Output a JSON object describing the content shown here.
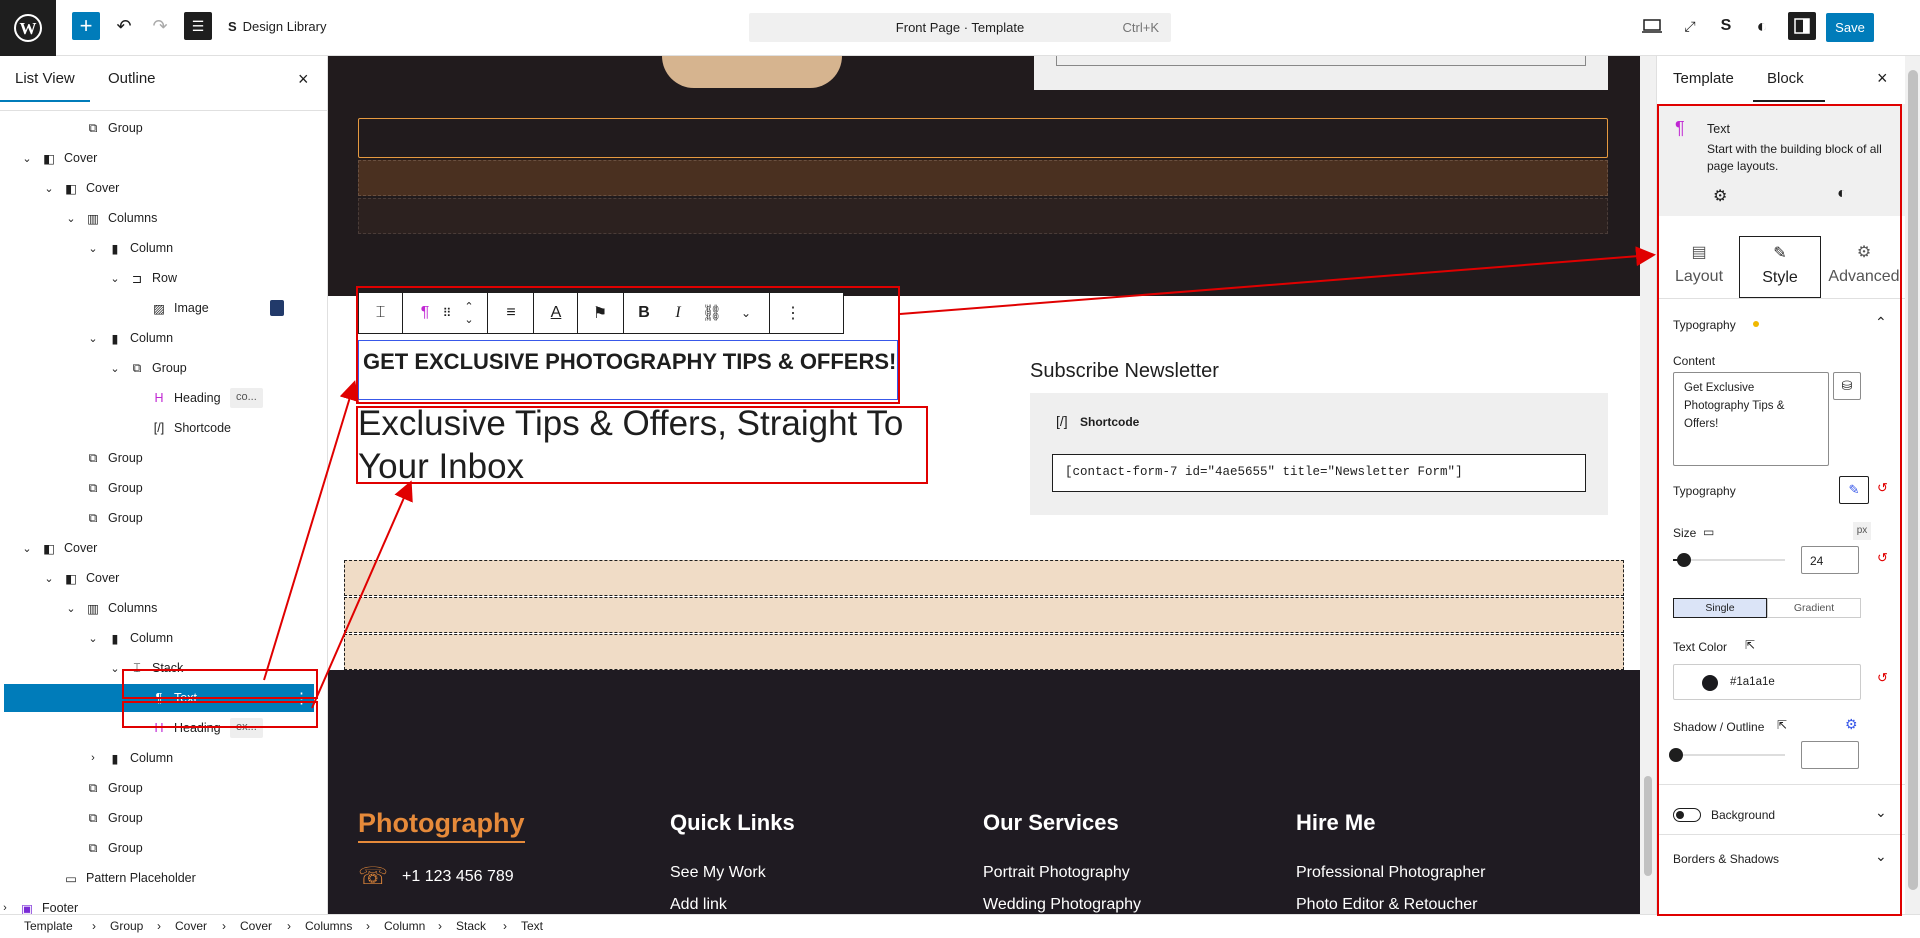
{
  "toolbar": {
    "design_library": "Design Library",
    "document_title": "Front Page · Template",
    "shortcut": "Ctrl+K",
    "save_label": "Save"
  },
  "left_panel": {
    "tabs": [
      "List View",
      "Outline"
    ],
    "rows": [
      {
        "label": "Group",
        "icon": "group-icon",
        "depth": 3
      },
      {
        "label": "Cover",
        "icon": "cover-icon",
        "depth": 1,
        "chev": "down"
      },
      {
        "label": "Cover",
        "icon": "cover-icon",
        "depth": 2,
        "chev": "down"
      },
      {
        "label": "Columns",
        "icon": "columns-icon",
        "depth": 3,
        "chev": "down"
      },
      {
        "label": "Column",
        "icon": "column-icon",
        "depth": 4,
        "chev": "down"
      },
      {
        "label": "Row",
        "icon": "row-icon",
        "depth": 5,
        "chev": "down"
      },
      {
        "label": "Image",
        "icon": "image-icon",
        "depth": 6,
        "thumb": true
      },
      {
        "label": "Column",
        "icon": "column-icon",
        "depth": 4,
        "chev": "down"
      },
      {
        "label": "Group",
        "icon": "group-icon",
        "depth": 5,
        "chev": "down"
      },
      {
        "label": "Heading",
        "icon": "heading-icon",
        "depth": 6,
        "pill": "co..."
      },
      {
        "label": "Shortcode",
        "icon": "shortcode-icon",
        "depth": 6
      },
      {
        "label": "Group",
        "icon": "group-icon",
        "depth": 3
      },
      {
        "label": "Group",
        "icon": "group-icon",
        "depth": 3
      },
      {
        "label": "Group",
        "icon": "group-icon",
        "depth": 3
      },
      {
        "label": "Cover",
        "icon": "cover-icon",
        "depth": 1,
        "chev": "down"
      },
      {
        "label": "Cover",
        "icon": "cover-icon",
        "depth": 2,
        "chev": "down"
      },
      {
        "label": "Columns",
        "icon": "columns-icon",
        "depth": 3,
        "chev": "down"
      },
      {
        "label": "Column",
        "icon": "column-icon",
        "depth": 4,
        "chev": "down"
      },
      {
        "label": "Stack",
        "icon": "stack-icon",
        "depth": 5,
        "chev": "down"
      },
      {
        "label": "Text",
        "icon": "paragraph-icon",
        "depth": 6,
        "selected": true
      },
      {
        "label": "Heading",
        "icon": "heading-icon",
        "depth": 6,
        "pill": "ex..."
      },
      {
        "label": "Column",
        "icon": "column-icon",
        "depth": 4,
        "chev": "right"
      },
      {
        "label": "Group",
        "icon": "group-icon",
        "depth": 3
      },
      {
        "label": "Group",
        "icon": "group-icon",
        "depth": 3
      },
      {
        "label": "Group",
        "icon": "group-icon",
        "depth": 3
      },
      {
        "label": "Pattern Placeholder",
        "icon": "pattern-icon",
        "depth": 2
      },
      {
        "label": "Footer",
        "icon": "footer-icon",
        "depth": 0,
        "chev": "right"
      }
    ]
  },
  "canvas": {
    "text_block": "GET EXCLUSIVE PHOTOGRAPHY TIPS & OFFERS!",
    "heading_line1": "Exclusive Tips & Offers, Straight To",
    "heading_line2": "Your Inbox",
    "subscribe_title": "Subscribe Newsletter",
    "shortcode_label": "Shortcode",
    "shortcode_value": "[contact-form-7 id=\"4ae5655\" title=\"Newsletter Form\"]",
    "footer": {
      "brand": "Photography",
      "phone": "+1 123 456 789",
      "col1_title": "Quick Links",
      "col1_items": [
        "See My Work",
        "Add link"
      ],
      "col2_title": "Our Services",
      "col2_items": [
        "Portrait Photography",
        "Wedding Photography"
      ],
      "col3_title": "Hire Me",
      "col3_items": [
        "Professional Photographer",
        "Photo Editor & Retoucher"
      ]
    }
  },
  "right_panel": {
    "tabs": [
      "Template",
      "Block"
    ],
    "block_name": "Text",
    "block_desc": "Start with the building block of all page layouts.",
    "sub_tabs": [
      "Layout",
      "Style",
      "Advanced"
    ],
    "typography_section": "Typography",
    "content_label": "Content",
    "content_value": "Get Exclusive Photography Tips & Offers!",
    "typography_label": "Typography",
    "size_label": "Size",
    "size_unit": "px",
    "size_value": "24",
    "size_level": 0.1,
    "color_modes": [
      "Single",
      "Gradient"
    ],
    "text_color_label": "Text Color",
    "text_color_value": "#1a1a1e",
    "shadow_label": "Shadow / Outline",
    "background_label": "Background",
    "borders_label": "Borders & Shadows"
  },
  "breadcrumbs": [
    "Template",
    "Group",
    "Cover",
    "Cover",
    "Columns",
    "Column",
    "Stack",
    "Text"
  ],
  "colors": {
    "accent": "#007cba",
    "annotation": "#e00000",
    "footer_bg": "#1f1b22",
    "brand_orange": "#e68a3a"
  }
}
